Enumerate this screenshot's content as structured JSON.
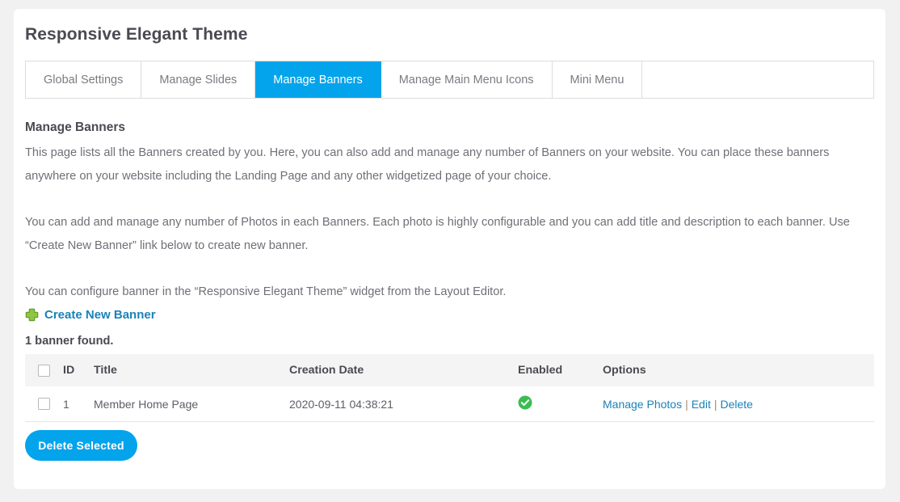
{
  "page": {
    "title": "Responsive Elegant Theme"
  },
  "tabs": [
    {
      "label": "Global Settings",
      "active": false
    },
    {
      "label": "Manage Slides",
      "active": false
    },
    {
      "label": "Manage Banners",
      "active": true
    },
    {
      "label": "Manage Main Menu Icons",
      "active": false
    },
    {
      "label": "Mini Menu",
      "active": false
    }
  ],
  "content": {
    "section_title": "Manage Banners",
    "paragraph_1": "This page lists all the Banners created by you. Here, you can also add and manage any number of Banners on your website. You can place these banners anywhere on your website including the Landing Page and any other widgetized page of your choice.",
    "paragraph_2": "You can add and manage any number of Photos in each Banners. Each photo is highly configurable and you can add title and description to each banner. Use “Create New Banner” link below to create new banner.",
    "paragraph_3": "You can configure banner in the “Responsive Elegant Theme” widget from the Layout Editor.",
    "create_link": "Create New Banner",
    "create_icon": "plus-icon",
    "found_text": "1 banner found."
  },
  "table": {
    "columns": [
      "ID",
      "Title",
      "Creation Date",
      "Enabled",
      "Options"
    ],
    "rows": [
      {
        "id": "1",
        "title": "Member Home Page",
        "creation_date": "2020-09-11 04:38:21",
        "enabled": true,
        "enabled_icon": "green-check-circle-icon",
        "options": [
          "Manage Photos",
          "Edit",
          "Delete"
        ],
        "options_separator": "|"
      }
    ]
  },
  "actions": {
    "delete_selected": "Delete Selected"
  },
  "colors": {
    "accent": "#04a4ec",
    "link": "#1b82b8",
    "success": "#3cbc53",
    "page_background": "#f1f1f2",
    "card_background": "#ffffff",
    "table_header_background": "#f4f4f4"
  }
}
